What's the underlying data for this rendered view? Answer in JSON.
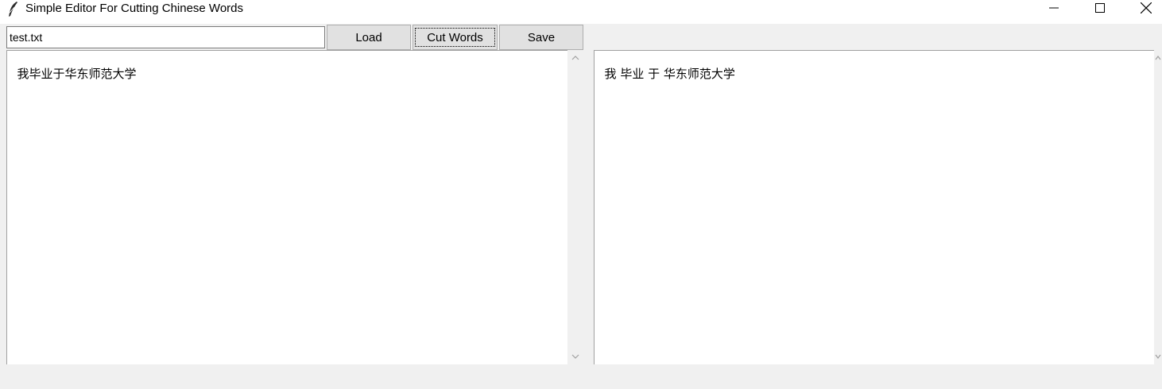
{
  "window": {
    "title": "Simple Editor For Cutting Chinese Words",
    "icon": "feather-icon",
    "controls": [
      "minimize-icon",
      "maximize-icon",
      "close-icon"
    ]
  },
  "toolbar": {
    "filename_value": "test.txt",
    "load_label": "Load",
    "cut_label": "Cut Words",
    "save_label": "Save"
  },
  "editor": {
    "input_text": "我毕业于华东师范大学",
    "output_text": "我 毕业 于 华东师范大学"
  },
  "colors": {
    "window_bg": "#f0f0f0",
    "button_bg": "#e1e1e1",
    "text_bg": "#ffffff"
  }
}
